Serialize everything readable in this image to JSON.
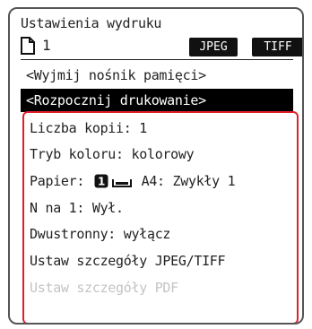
{
  "screen": {
    "title": "Ustawienia wydruku",
    "copies_indicator": "1",
    "format_buttons": [
      "JPEG",
      "TIFF"
    ]
  },
  "menu": {
    "eject": "<Wyjmij nośnik pamięci>",
    "start": "<Rozpocznij drukowanie>"
  },
  "settings": {
    "copies": "Liczba kopii: 1",
    "color_mode": "Tryb koloru: kolorowy",
    "paper_prefix": "Papier:",
    "paper_tray_number": "1",
    "paper_value": "A4: Zwykły 1",
    "n_on_1": "N na 1: Wył.",
    "duplex": "Dwustronny: wyłącz",
    "jpeg_tiff_details": "Ustaw szczegóły JPEG/TIFF",
    "pdf_details": "Ustaw szczegóły PDF"
  },
  "colors": {
    "highlight_border": "#e0202a",
    "selected_bg": "#000000",
    "disabled_text": "#c4c4c4"
  },
  "icons": {
    "document": "document-icon",
    "paper_tray": "paper-tray-icon"
  }
}
